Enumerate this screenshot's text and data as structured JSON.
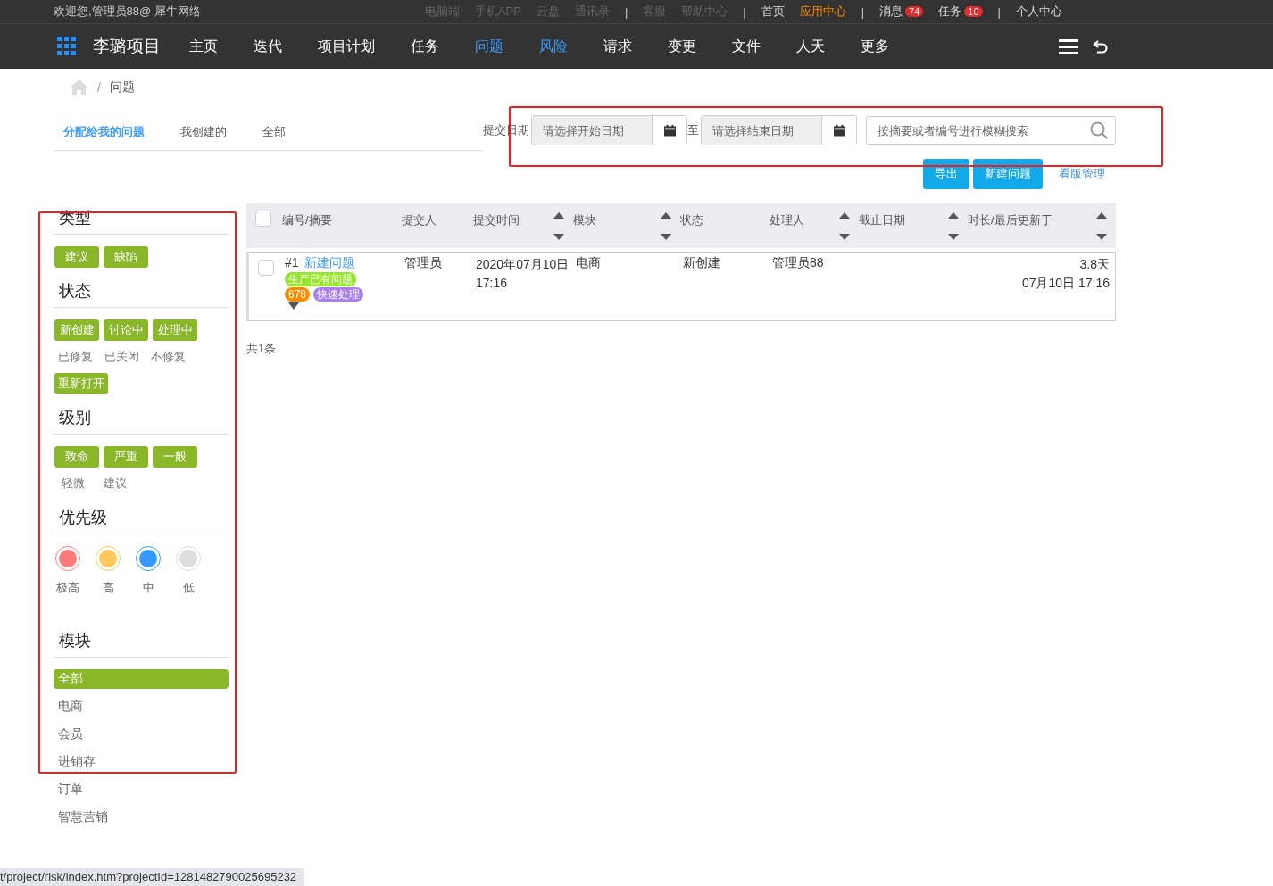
{
  "top_bar": {
    "welcome": "欢迎您,管理员88@ 犀牛网络",
    "links": [
      {
        "kind": "muted",
        "label": "电脑端"
      },
      {
        "kind": "muted",
        "label": "手机APP"
      },
      {
        "kind": "muted",
        "label": "云盘"
      },
      {
        "kind": "muted",
        "label": "通讯录"
      },
      {
        "kind": "separator",
        "label": "|"
      },
      {
        "kind": "muted",
        "label": "客服"
      },
      {
        "kind": "muted",
        "label": "帮助中心"
      },
      {
        "kind": "separator",
        "label": "|"
      },
      {
        "kind": "link",
        "label": "首页"
      },
      {
        "kind": "highlight",
        "label": "应用中心"
      },
      {
        "kind": "separator",
        "label": "|"
      },
      {
        "kind": "link",
        "label": "消息",
        "badge": "74"
      },
      {
        "kind": "link",
        "label": "任务",
        "badge": "10"
      },
      {
        "kind": "separator",
        "label": "|"
      },
      {
        "kind": "link",
        "label": "个人中心"
      }
    ]
  },
  "nav": {
    "project": "李璐项目",
    "items": [
      {
        "label": "主页",
        "selected": false
      },
      {
        "label": "迭代",
        "selected": false
      },
      {
        "label": "项目计划",
        "selected": false
      },
      {
        "label": "任务",
        "selected": false
      },
      {
        "label": "问题",
        "selected": true
      },
      {
        "label": "风险",
        "selected": true
      },
      {
        "label": "请求",
        "selected": false
      },
      {
        "label": "变更",
        "selected": false
      },
      {
        "label": "文件",
        "selected": false
      },
      {
        "label": "人天",
        "selected": false
      },
      {
        "label": "更多",
        "selected": false
      }
    ]
  },
  "breadcrumb": {
    "separator": "/",
    "current": "问题"
  },
  "tabs": [
    {
      "label": "分配给我的问题",
      "selected": true
    },
    {
      "label": "我创建的",
      "selected": false
    },
    {
      "label": "全部",
      "selected": false
    }
  ],
  "filter": {
    "date_label": "提交日期",
    "start_placeholder": "请选择开始日期",
    "to": "至",
    "end_placeholder": "请选择结束日期",
    "search_placeholder": "按摘要或者编号进行模糊搜索"
  },
  "actions": {
    "buttons": [
      "导出",
      "新建问题"
    ],
    "link": "看版管理"
  },
  "sidebar": [
    {
      "kind": "tags",
      "title": "类型",
      "items": [
        {
          "label": "建议",
          "selected": true
        },
        {
          "label": "缺陷",
          "selected": true
        }
      ]
    },
    {
      "kind": "tags",
      "title": "状态",
      "items": [
        {
          "label": "新创建",
          "selected": true
        },
        {
          "label": "讨论中",
          "selected": true
        },
        {
          "label": "处理中",
          "selected": true
        },
        {
          "label": "已修复",
          "selected": false
        },
        {
          "label": "已关闭",
          "selected": false
        },
        {
          "label": "不修复",
          "selected": false
        },
        {
          "label": "重新打开",
          "selected": true
        }
      ]
    },
    {
      "kind": "tags",
      "title": "级别",
      "items": [
        {
          "label": "致命",
          "selected": true
        },
        {
          "label": "严重",
          "selected": true
        },
        {
          "label": "一般",
          "selected": true
        },
        {
          "label": "轻微",
          "selected": false
        },
        {
          "label": "建议",
          "selected": false
        }
      ]
    },
    {
      "kind": "dots",
      "title": "优先级",
      "items": [
        {
          "label": "极高",
          "color": "#ff7b7b"
        },
        {
          "label": "高",
          "color": "#ffc85c"
        },
        {
          "label": "中",
          "color": "#3399ff"
        },
        {
          "label": "低",
          "color": "#dddddd"
        }
      ]
    },
    {
      "kind": "list",
      "title": "模块",
      "items": [
        {
          "label": "全部",
          "selected": true
        },
        {
          "label": "电商",
          "selected": false
        },
        {
          "label": "会员",
          "selected": false
        },
        {
          "label": "进销存",
          "selected": false
        },
        {
          "label": "订单",
          "selected": false
        },
        {
          "label": "智慧营销",
          "selected": false
        }
      ]
    }
  ],
  "table": {
    "select_all": false,
    "columns": [
      {
        "label": "编号/摘要",
        "sortable": false
      },
      {
        "label": "提交人",
        "sortable": false
      },
      {
        "label": "提交时间",
        "sortable": true
      },
      {
        "label": "模块",
        "sortable": true
      },
      {
        "label": "状态",
        "sortable": false
      },
      {
        "label": "处理人",
        "sortable": true
      },
      {
        "label": "截止日期",
        "sortable": true
      },
      {
        "label": "时长/最后更新于",
        "sortable": true
      }
    ],
    "rows": [
      {
        "checked": false,
        "number": "#1",
        "title": "新建问题",
        "tags": [
          {
            "label": "生产已有问题",
            "color": "#99e62e"
          },
          {
            "label": "678",
            "color": "#ff8c00"
          },
          {
            "label": "快速处理",
            "color": "#a97ff0"
          }
        ],
        "submitter": "管理员",
        "submitted": [
          "2020年07月10日",
          "17:16"
        ],
        "module": "电商",
        "status": "新创建",
        "handler": "管理员88",
        "duration": [
          "3.8天",
          "07月10日 17:16"
        ]
      }
    ]
  },
  "total": "共1条",
  "status_bar": "t/project/risk/index.htm?projectId=1281482790025695232"
}
